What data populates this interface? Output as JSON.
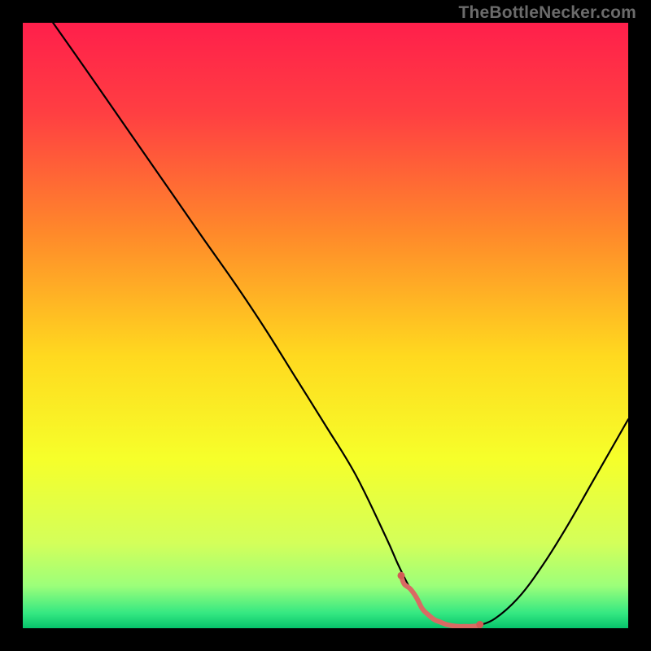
{
  "watermark": "TheBottleNecker.com",
  "chart_data": {
    "type": "line",
    "title": "",
    "xlabel": "",
    "ylabel": "",
    "xlim": [
      0,
      100
    ],
    "ylim": [
      0,
      100
    ],
    "grid": false,
    "background_gradient": {
      "stops": [
        {
          "offset": 0.0,
          "color": "#ff1f4b"
        },
        {
          "offset": 0.15,
          "color": "#ff3f42"
        },
        {
          "offset": 0.35,
          "color": "#ff8a2a"
        },
        {
          "offset": 0.55,
          "color": "#ffd91f"
        },
        {
          "offset": 0.72,
          "color": "#f6ff2a"
        },
        {
          "offset": 0.86,
          "color": "#d3ff5a"
        },
        {
          "offset": 0.93,
          "color": "#9cff7a"
        },
        {
          "offset": 0.975,
          "color": "#35e882"
        },
        {
          "offset": 1.0,
          "color": "#06c36b"
        }
      ]
    },
    "series": [
      {
        "name": "bottleneck-curve",
        "stroke": "#000000",
        "stroke_width": 2.2,
        "x": [
          5,
          10,
          15,
          20,
          25,
          30,
          35,
          40,
          45,
          50,
          55,
          60,
          62,
          64,
          66,
          68,
          70,
          72,
          74,
          75,
          78,
          82,
          86,
          90,
          94,
          98,
          100
        ],
        "values": [
          100,
          92.9,
          85.7,
          78.5,
          71.3,
          64.1,
          57,
          49.5,
          41.5,
          33.5,
          25.3,
          15,
          10.5,
          6.5,
          3.2,
          1.4,
          0.6,
          0.3,
          0.3,
          0.4,
          1.6,
          5.2,
          10.6,
          17,
          24,
          31,
          34.5
        ]
      }
    ],
    "highlight_segment": {
      "name": "optimal-range-highlight",
      "stroke": "#d96a63",
      "stroke_width": 6,
      "x": [
        62.5,
        63,
        64,
        65,
        66,
        67,
        68,
        69,
        70,
        71,
        72,
        73,
        74,
        75,
        75.5
      ],
      "values": [
        8.7,
        7.3,
        6.5,
        5.1,
        3.2,
        2.2,
        1.4,
        1.0,
        0.6,
        0.4,
        0.3,
        0.3,
        0.3,
        0.4,
        0.6
      ]
    },
    "highlight_endpoints": {
      "color": "#d25b55",
      "radius": 4.5,
      "points": [
        {
          "x": 62.5,
          "y": 8.7
        },
        {
          "x": 75.5,
          "y": 0.6
        }
      ]
    }
  }
}
